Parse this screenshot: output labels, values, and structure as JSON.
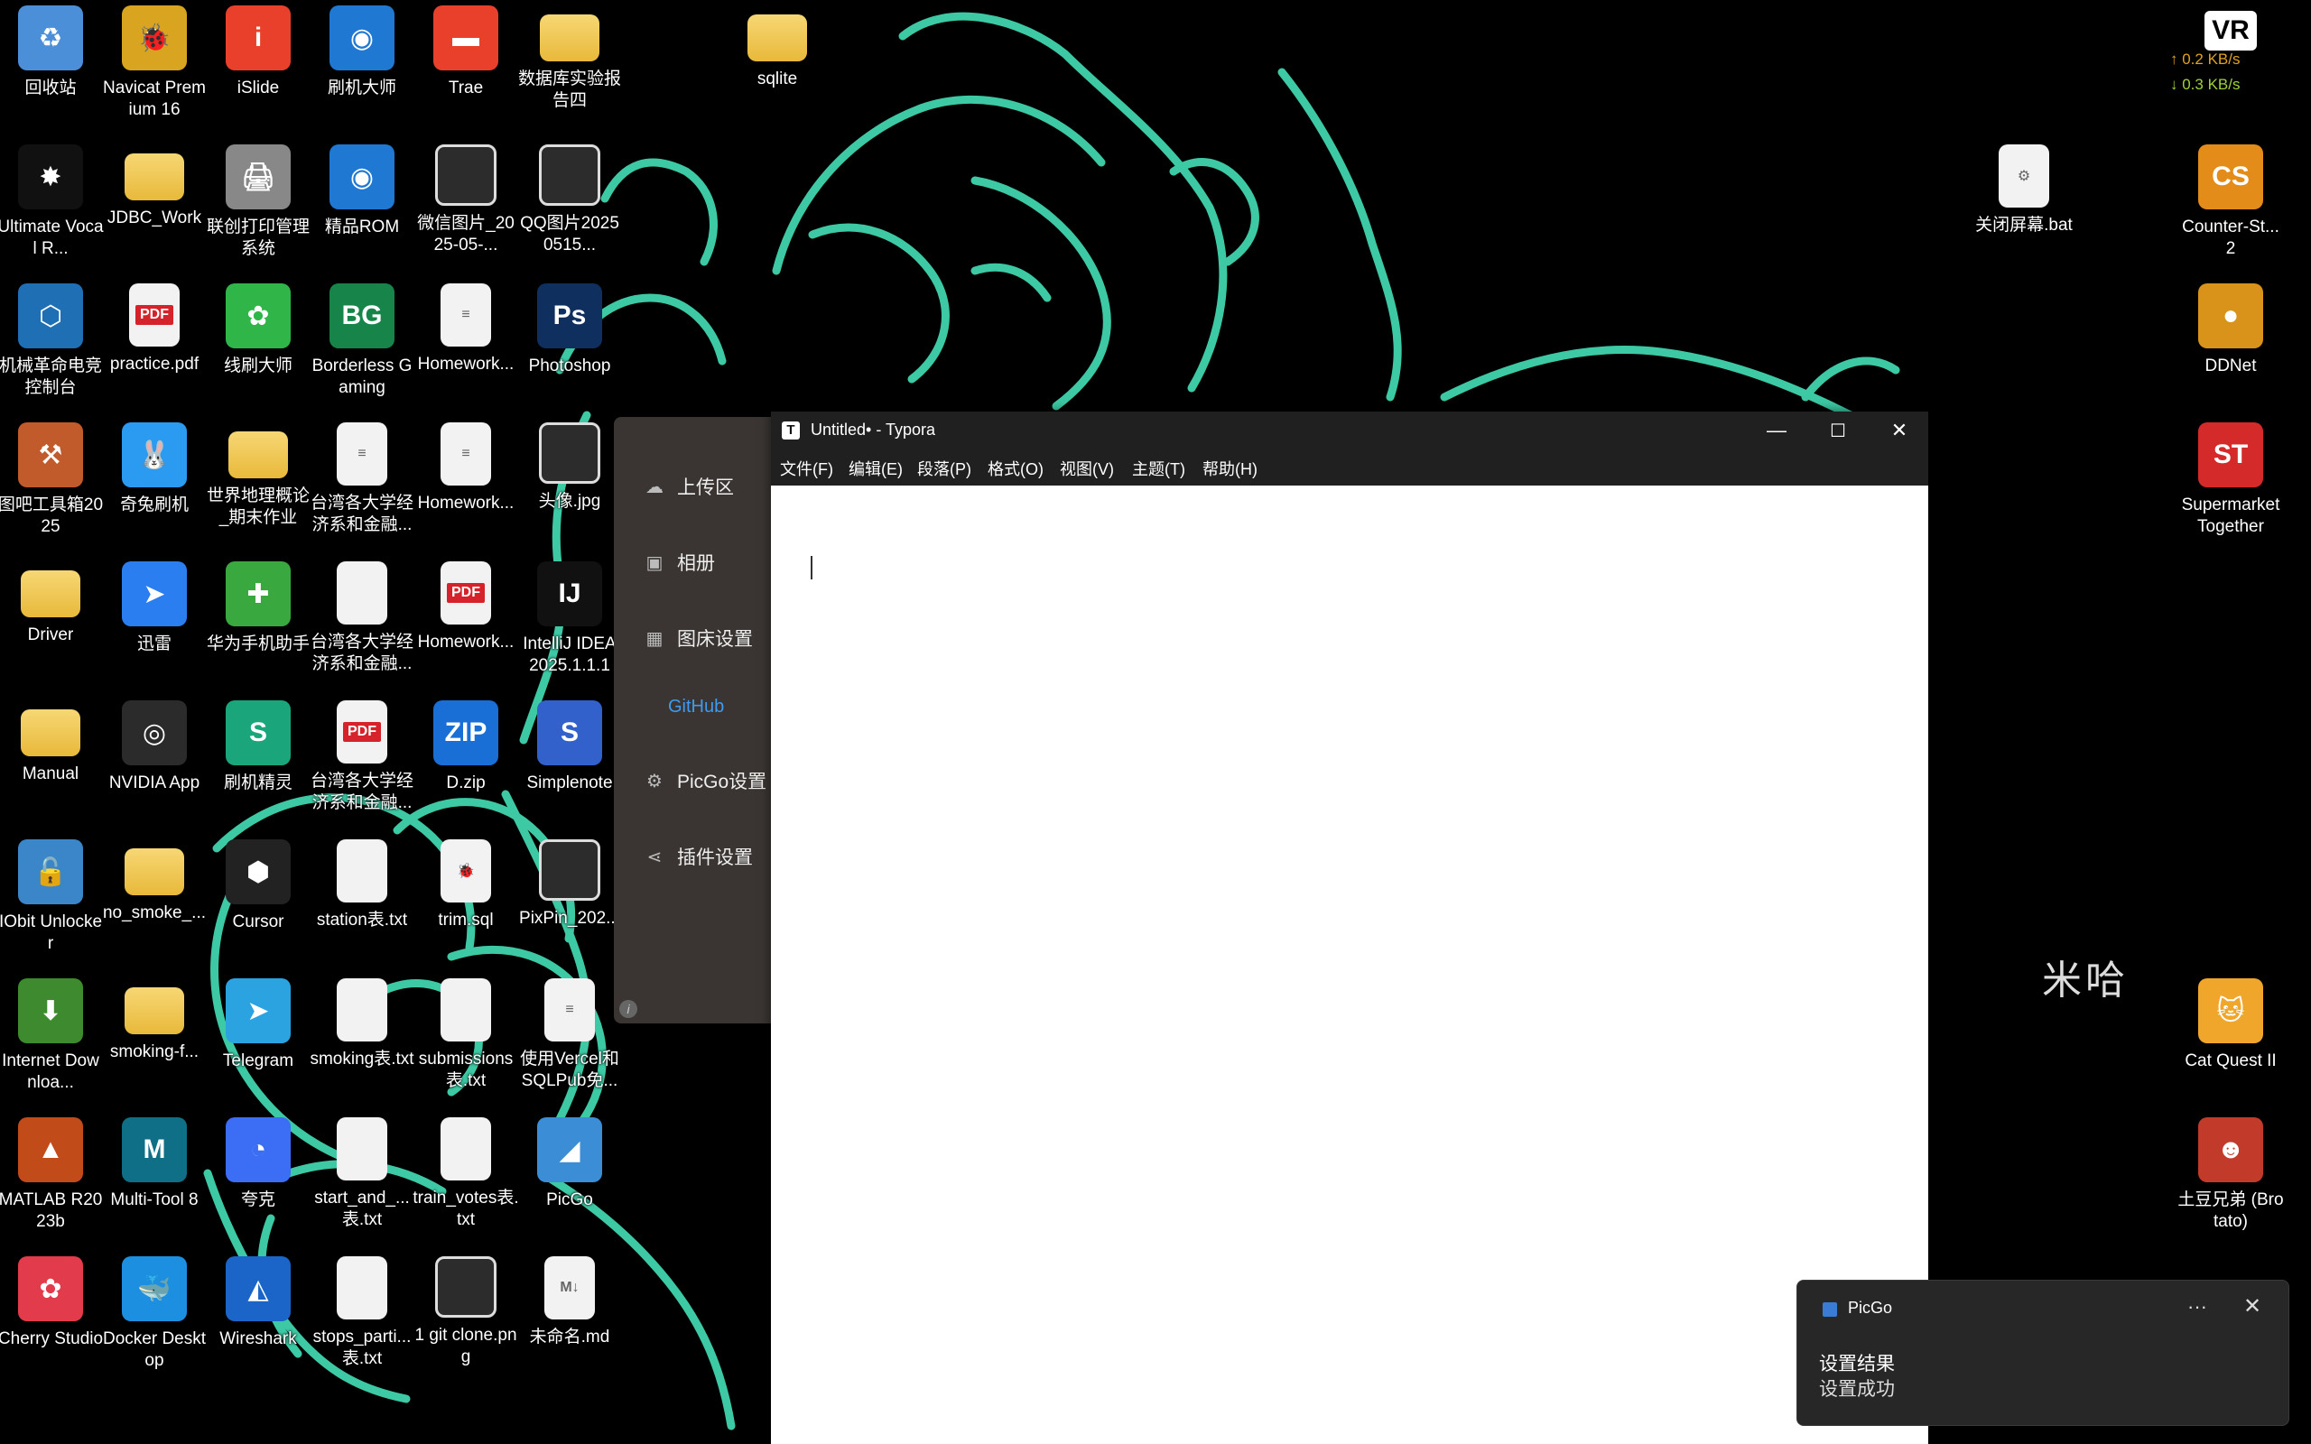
{
  "desktop": {
    "icons": [
      {
        "label": "回收站",
        "glyph": "♻",
        "color": "#4a8fd8"
      },
      {
        "label": "Navicat Premium 16",
        "glyph": "🐞",
        "color": "#d9a520"
      },
      {
        "label": "iSlide",
        "glyph": "i",
        "color": "#e8402b"
      },
      {
        "label": "刷机大师",
        "glyph": "◉",
        "color": "#1f78d1"
      },
      {
        "label": "Trae",
        "glyph": "▬",
        "color": "#e8402b"
      },
      {
        "label": "数据库实验报告四",
        "glyph": "",
        "color": "folder"
      },
      {
        "label": "sqlite",
        "glyph": "",
        "color": "folder"
      },
      {
        "label": "Ultimate Vocal R...",
        "glyph": "✸",
        "color": "#111"
      },
      {
        "label": "JDBC_Work",
        "glyph": "",
        "color": "folder"
      },
      {
        "label": "联创打印管理系统",
        "glyph": "🖨",
        "color": "#888"
      },
      {
        "label": "精品ROM",
        "glyph": "◉",
        "color": "#1f78d1"
      },
      {
        "label": "微信图片_2025-05-...",
        "glyph": "",
        "color": "img"
      },
      {
        "label": "QQ图片20250515...",
        "glyph": "",
        "color": "img"
      },
      {
        "label": "机械革命电竞控制台",
        "glyph": "⬡",
        "color": "#1f6fb5"
      },
      {
        "label": "practice.pdf",
        "glyph": "PDF",
        "color": "pdf"
      },
      {
        "label": "线刷大师",
        "glyph": "✿",
        "color": "#2fb548"
      },
      {
        "label": "Borderless Gaming",
        "glyph": "BG",
        "color": "#17854a"
      },
      {
        "label": "Homework...",
        "glyph": "≡",
        "color": "doc"
      },
      {
        "label": "Photoshop",
        "glyph": "Ps",
        "color": "#0f2f5e"
      },
      {
        "label": "图吧工具箱2025",
        "glyph": "⚒",
        "color": "#c25b2c"
      },
      {
        "label": "奇兔刷机",
        "glyph": "🐰",
        "color": "#2a9bf0"
      },
      {
        "label": "世界地理概论_期末作业",
        "glyph": "",
        "color": "folder"
      },
      {
        "label": "台湾各大学经济系和金融...",
        "glyph": "≡",
        "color": "doc"
      },
      {
        "label": "Homework...",
        "glyph": "≡",
        "color": "doc"
      },
      {
        "label": "头像.jpg",
        "glyph": "",
        "color": "img"
      },
      {
        "label": "Driver",
        "glyph": "",
        "color": "folder"
      },
      {
        "label": "迅雷",
        "glyph": "➤",
        "color": "#2a7ef0"
      },
      {
        "label": "华为手机助手",
        "glyph": "✚",
        "color": "#39a83e"
      },
      {
        "label": "台湾各大学经济系和金融...",
        "glyph": "",
        "color": "doc"
      },
      {
        "label": "Homework...",
        "glyph": "PDF",
        "color": "pdf"
      },
      {
        "label": "IntelliJ IDEA 2025.1.1.1",
        "glyph": "IJ",
        "color": "#111"
      },
      {
        "label": "Manual",
        "glyph": "",
        "color": "folder"
      },
      {
        "label": "NVIDIA App",
        "glyph": "◎",
        "color": "#2b2b2b"
      },
      {
        "label": "刷机精灵",
        "glyph": "S",
        "color": "#1aa57a"
      },
      {
        "label": "台湾各大学经济系和金融...",
        "glyph": "PDF",
        "color": "pdf"
      },
      {
        "label": "D.zip",
        "glyph": "ZIP",
        "color": "#1a6fd6"
      },
      {
        "label": "Simplenote",
        "glyph": "S",
        "color": "#3361cc"
      },
      {
        "label": "IObit Unlocker",
        "glyph": "🔓",
        "color": "#3a86c8"
      },
      {
        "label": "no_smoke_...",
        "glyph": "",
        "color": "folder"
      },
      {
        "label": "Cursor",
        "glyph": "⬢",
        "color": "#222"
      },
      {
        "label": "station表.txt",
        "glyph": "",
        "color": "doc"
      },
      {
        "label": "trim.sql",
        "glyph": "🐞",
        "color": "doc"
      },
      {
        "label": "PixPin_202...",
        "glyph": "",
        "color": "img"
      },
      {
        "label": "Internet Downloa...",
        "glyph": "⬇",
        "color": "#3d8a2f"
      },
      {
        "label": "smoking-f...",
        "glyph": "",
        "color": "folder"
      },
      {
        "label": "Telegram",
        "glyph": "➤",
        "color": "#2aa3e0"
      },
      {
        "label": "smoking表.txt",
        "glyph": "",
        "color": "doc"
      },
      {
        "label": "submissions表.txt",
        "glyph": "",
        "color": "doc"
      },
      {
        "label": "使用Vercel和SQLPub免...",
        "glyph": "≡",
        "color": "doc"
      },
      {
        "label": "MATLAB R2023b",
        "glyph": "▲",
        "color": "#c24b1a"
      },
      {
        "label": "Multi-Tool 8",
        "glyph": "M",
        "color": "#0f6f86"
      },
      {
        "label": "夸克",
        "glyph": "◔",
        "color": "#3b6ef5"
      },
      {
        "label": "start_and_...表.txt",
        "glyph": "",
        "color": "doc"
      },
      {
        "label": "train_votes表.txt",
        "glyph": "",
        "color": "doc"
      },
      {
        "label": "PicGo",
        "glyph": "◢",
        "color": "#3b8dd6"
      },
      {
        "label": "Cherry Studio",
        "glyph": "✿",
        "color": "#e23b4b"
      },
      {
        "label": "Docker Desktop",
        "glyph": "🐳",
        "color": "#1d8fe0"
      },
      {
        "label": "Wireshark",
        "glyph": "◭",
        "color": "#1a65c7"
      },
      {
        "label": "stops_parti...表.txt",
        "glyph": "",
        "color": "doc"
      },
      {
        "label": "1 git clone.png",
        "glyph": "",
        "color": "img"
      },
      {
        "label": "未命名.md",
        "glyph": "M↓",
        "color": "doc"
      },
      {
        "label": "关闭屏幕.bat",
        "glyph": "⚙",
        "color": "doc"
      },
      {
        "label": "Counter-St... 2",
        "glyph": "CS",
        "color": "#e48c1a"
      },
      {
        "label": "DDNet",
        "glyph": "●",
        "color": "#d9931a"
      },
      {
        "label": "Supermarket Together",
        "glyph": "ST",
        "color": "#d42a2a"
      },
      {
        "label": "Cat Quest II",
        "glyph": "🐱",
        "color": "#f0a62a"
      },
      {
        "label": "土豆兄弟 (Brotato)",
        "glyph": "☻",
        "color": "#c23b2a"
      }
    ]
  },
  "picgo": {
    "items": [
      {
        "label": "上传区",
        "icon": "cloud-upload-icon",
        "glyph": "☁"
      },
      {
        "label": "相册",
        "icon": "image-icon",
        "glyph": "▣"
      },
      {
        "label": "图床设置",
        "icon": "grid-icon",
        "glyph": "▦"
      },
      {
        "label": "PicGo设置",
        "icon": "gear-icon",
        "glyph": "⚙"
      },
      {
        "label": "插件设置",
        "icon": "share-icon",
        "glyph": "⋖"
      }
    ],
    "github": "GitHub",
    "info": "i"
  },
  "typora": {
    "title": "Untitled• - Typora",
    "logo": "T",
    "controls": {
      "minimize": "—",
      "maximize": "☐",
      "close": "✕"
    },
    "menu": [
      "文件(F)",
      "编辑(E)",
      "段落(P)",
      "格式(O)",
      "视图(V)",
      "主题(T)",
      "帮助(H)"
    ]
  },
  "toast": {
    "app": "PicGo",
    "more": "···",
    "close": "✕",
    "title": "设置结果",
    "body": "设置成功"
  },
  "netspeed": {
    "vr": "VR",
    "up": "↑ 0.2 KB/s",
    "down": "↓ 0.3 KB/s",
    "up_color": "#e0a21f",
    "down_color": "#9fd23a"
  },
  "wallpaper": {
    "stroke_color": "#3cc9a4",
    "watermark": "米哈"
  }
}
